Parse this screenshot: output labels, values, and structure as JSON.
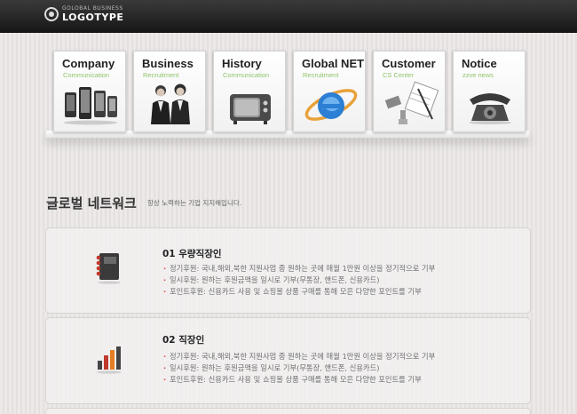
{
  "header": {
    "logo_small": "GOLOBAL BUSINESS",
    "logo_big": "LOGOTYPE"
  },
  "nav_cards": [
    {
      "title": "Company",
      "subtitle": "Communication",
      "icon": "smartphones-icon"
    },
    {
      "title": "Business",
      "subtitle": "Recruitment",
      "icon": "business-people-icon"
    },
    {
      "title": "History",
      "subtitle": "Communication",
      "icon": "retro-tv-icon"
    },
    {
      "title": "Global NET",
      "subtitle": "Recruitment",
      "icon": "internet-explorer-icon"
    },
    {
      "title": "Customer",
      "subtitle": "CS Center",
      "icon": "office-supplies-icon"
    },
    {
      "title": "Notice",
      "subtitle": "zzve news",
      "icon": "telephone-icon"
    }
  ],
  "section": {
    "title": "글로벌 네트워크",
    "description": "항상 노력하는 기업 지지해입니다."
  },
  "panels": [
    {
      "title": "01 우량직장인",
      "icon": "notebook-icon",
      "lines": [
        "정기후원: 국내,해외,북한 지원사업 중 원하는 곳에 매월 1만원 이상을 정기적으로 기부",
        "일시후원: 원하는 후원금액을 일시로 기부(무통장, 핸드폰, 신용카드)",
        "포인트후원: 신용카드 사용 및 쇼핑몰 상품 구매를 통해 모은 다양한 포인트를 기부"
      ]
    },
    {
      "title": "02 직장인",
      "icon": "bar-chart-icon",
      "lines": [
        "정기후원: 국내,해외,북한 지원사업 중 원하는 곳에 매월 1만원 이상을 정기적으로 기부",
        "일시후원: 원하는 후원금액을 일시로 기부(무통장, 핸드폰, 신용카드)",
        "포인트후원: 신용카드 사용 및 쇼핑몰 상품 구매를 통해 모은 다양한 포인트를 기부"
      ]
    }
  ],
  "colors": {
    "header_bg": "#1e1e1e",
    "card_subtitle": "#8fc46a",
    "bullet": "#dd4444",
    "accent_red": "#c0392b"
  }
}
